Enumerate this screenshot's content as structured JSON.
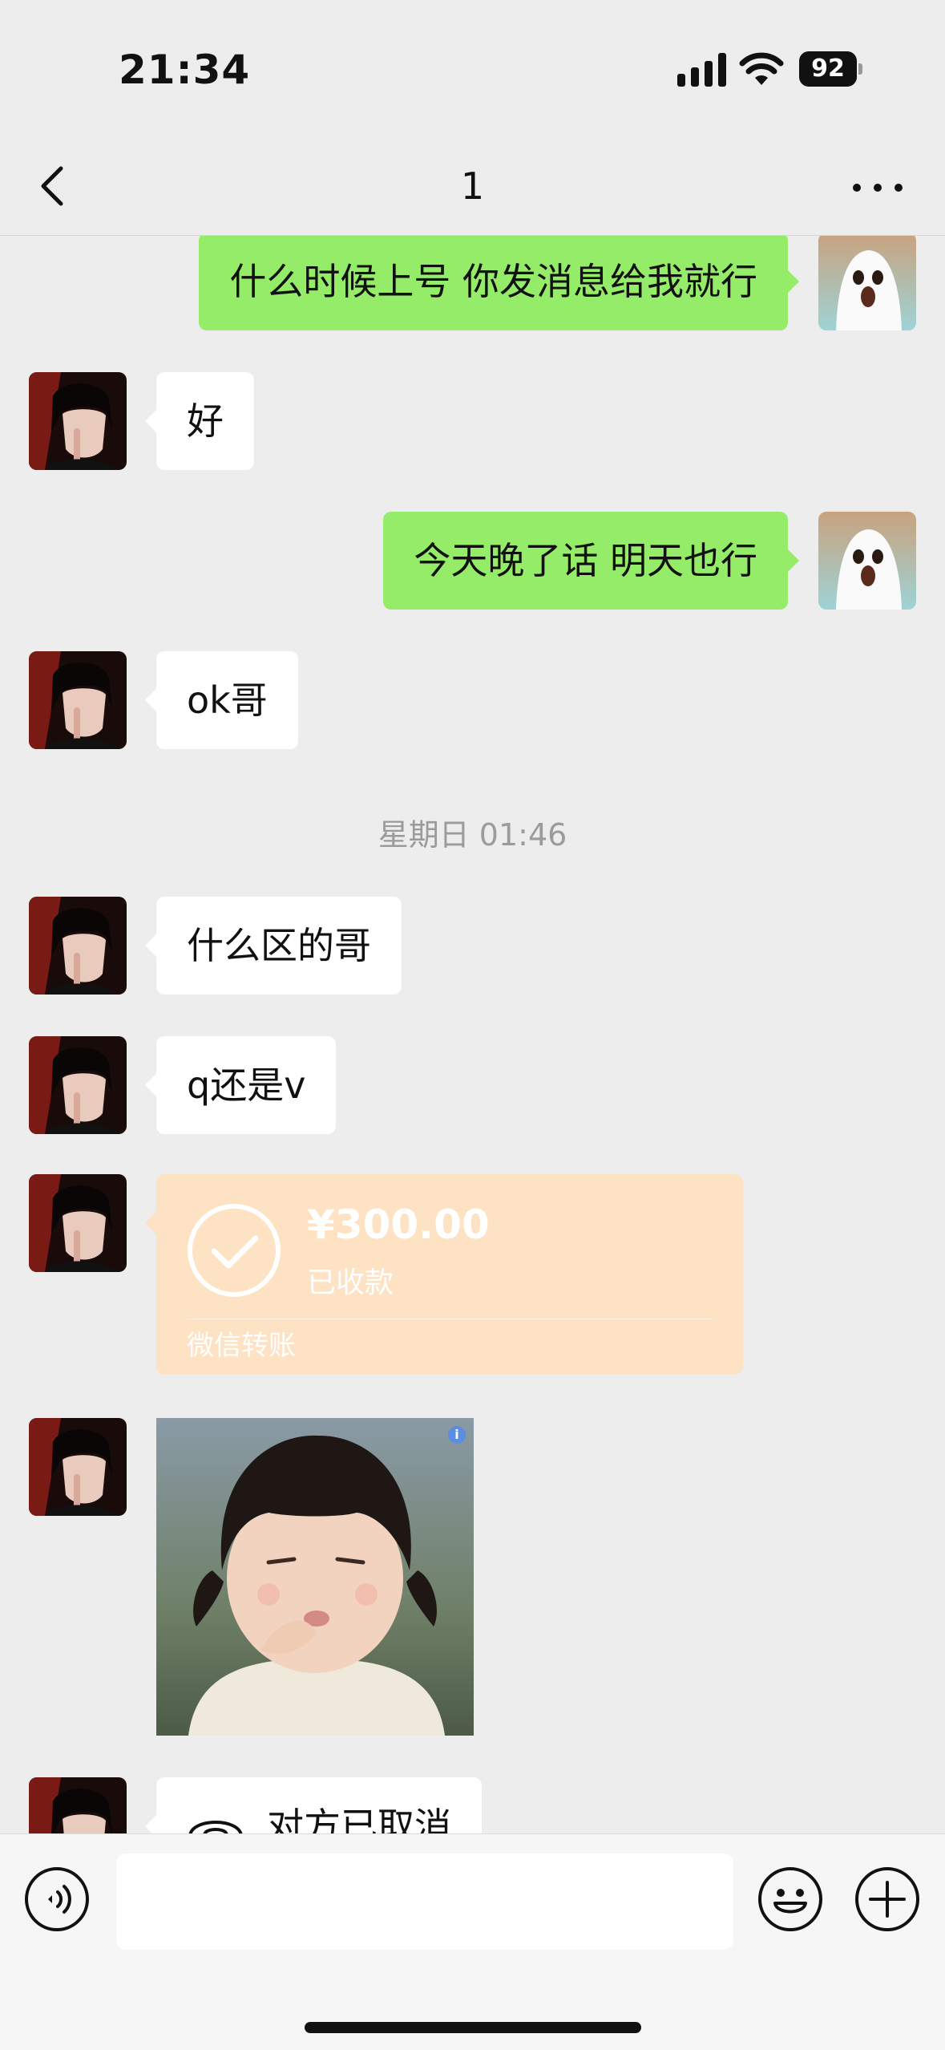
{
  "status_bar": {
    "time": "21:34",
    "battery": "92"
  },
  "nav": {
    "title": "1"
  },
  "messages": [
    {
      "from": "me",
      "text": "什么时候上号 你发消息给我就行"
    },
    {
      "from": "them",
      "text": "好"
    },
    {
      "from": "me",
      "text": "今天晚了话 明天也行"
    },
    {
      "from": "them",
      "text": "ok哥"
    },
    {
      "type": "timestamp",
      "text": "星期日 01:46"
    },
    {
      "from": "them",
      "text": "什么区的哥"
    },
    {
      "from": "them",
      "text": "q还是v"
    },
    {
      "from": "them",
      "type": "transfer",
      "amount": "¥300.00",
      "status": "已收款",
      "label": "微信转账"
    },
    {
      "from": "them",
      "type": "sticker"
    },
    {
      "from": "them",
      "type": "call",
      "text": "对方已取消"
    }
  ],
  "input": {
    "value": "",
    "placeholder": ""
  },
  "colors": {
    "background": "#ededed",
    "outgoing_bubble": "#95ec69",
    "incoming_bubble": "#ffffff",
    "transfer_card": "#fde2c3"
  }
}
